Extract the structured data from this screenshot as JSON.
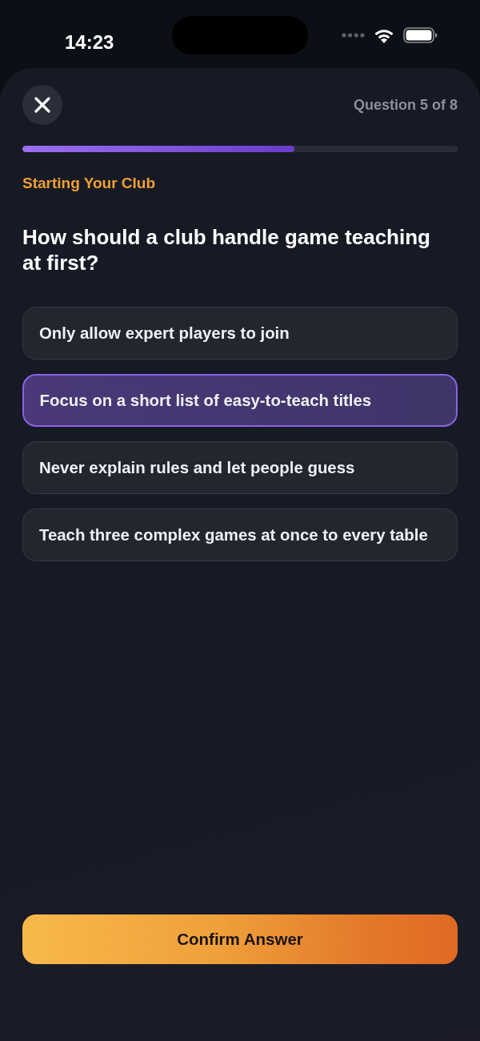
{
  "status_bar": {
    "time": "14:23"
  },
  "header": {
    "counter": "Question 5 of 8"
  },
  "progress": {
    "level": 0.625
  },
  "category": "Starting Your Club",
  "question": "How should a club handle game teaching at first?",
  "options": [
    {
      "label": "Only allow expert players to join",
      "selected": false
    },
    {
      "label": "Focus on a short list of easy-to-teach titles",
      "selected": true
    },
    {
      "label": "Never explain rules and let people guess",
      "selected": false
    },
    {
      "label": "Teach three complex games at once to every table",
      "selected": false
    }
  ],
  "confirm_button": {
    "label": "Confirm Answer"
  }
}
